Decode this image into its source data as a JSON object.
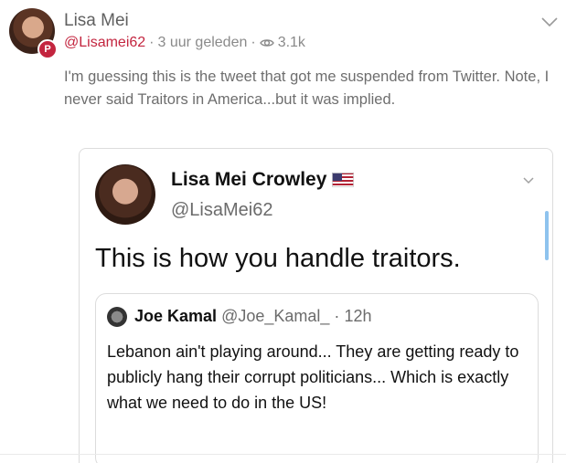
{
  "post": {
    "display_name": "Lisa Mei",
    "handle": "@Lisamei62",
    "separator": "·",
    "time": "3 uur geleden",
    "views": "3.1k",
    "badge_letter": "P",
    "text": "I'm guessing this is the tweet that got me suspended from Twitter. Note, I never said Traitors in America...but it was implied."
  },
  "embed": {
    "name": "Lisa Mei Crowley",
    "handle": "@LisaMei62",
    "text": "This is how you handle traitors.",
    "quote": {
      "name": "Joe Kamal",
      "handle": "@Joe_Kamal_",
      "separator": "·",
      "time": "12h",
      "text": "Lebanon ain't playing around... They are getting ready to publicly hang their corrupt politicians... Which is exactly what we need to do in the US!"
    }
  },
  "icons": {
    "parler_badge": "parler-logo-icon",
    "views": "eye-icon",
    "menu": "chevron-down-icon",
    "flag": "us-flag-icon"
  },
  "colors": {
    "accent": "#c3253f",
    "scroll": "#8ec3ee"
  }
}
